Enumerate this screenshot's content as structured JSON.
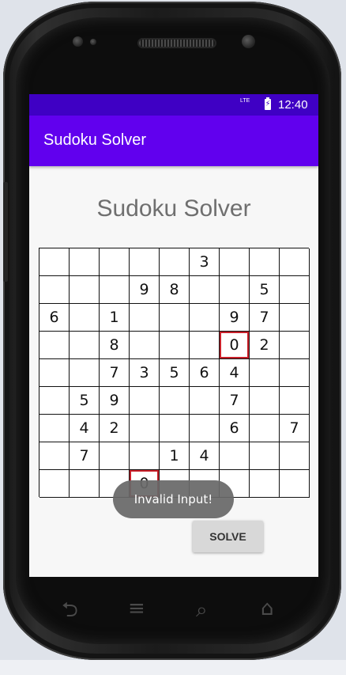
{
  "status_bar": {
    "network": "LTE",
    "time": "12:40"
  },
  "app_bar": {
    "title": "Sudoku Solver"
  },
  "main": {
    "heading": "Sudoku Solver",
    "grid": [
      [
        "",
        "",
        "",
        "",
        "",
        "3",
        "",
        "",
        ""
      ],
      [
        "",
        "",
        "",
        "9",
        "8",
        "",
        "",
        "5",
        ""
      ],
      [
        "6",
        "",
        "1",
        "",
        "",
        "",
        "9",
        "7",
        ""
      ],
      [
        "",
        "",
        "8",
        "",
        "",
        "",
        "0",
        "2",
        ""
      ],
      [
        "",
        "",
        "7",
        "3",
        "5",
        "6",
        "4",
        "",
        ""
      ],
      [
        "",
        "5",
        "9",
        "",
        "",
        "",
        "7",
        "",
        ""
      ],
      [
        "",
        "4",
        "2",
        "",
        "",
        "",
        "6",
        "",
        "7"
      ],
      [
        "",
        "7",
        "",
        "",
        "1",
        "4",
        "",
        "",
        ""
      ],
      [
        "",
        "",
        "",
        "0",
        "",
        "",
        "",
        "",
        ""
      ]
    ],
    "invalid_cells": [
      [
        3,
        6
      ],
      [
        8,
        3
      ]
    ],
    "toast": "Invalid Input!",
    "solve_label": "SOLVE"
  },
  "nav_bar": {
    "icons": [
      "back-icon",
      "menu-icon",
      "search-icon",
      "home-icon"
    ]
  },
  "colors": {
    "status_bar": "#3f00c4",
    "app_bar": "#6100ee",
    "invalid_border": "#c8202a"
  }
}
